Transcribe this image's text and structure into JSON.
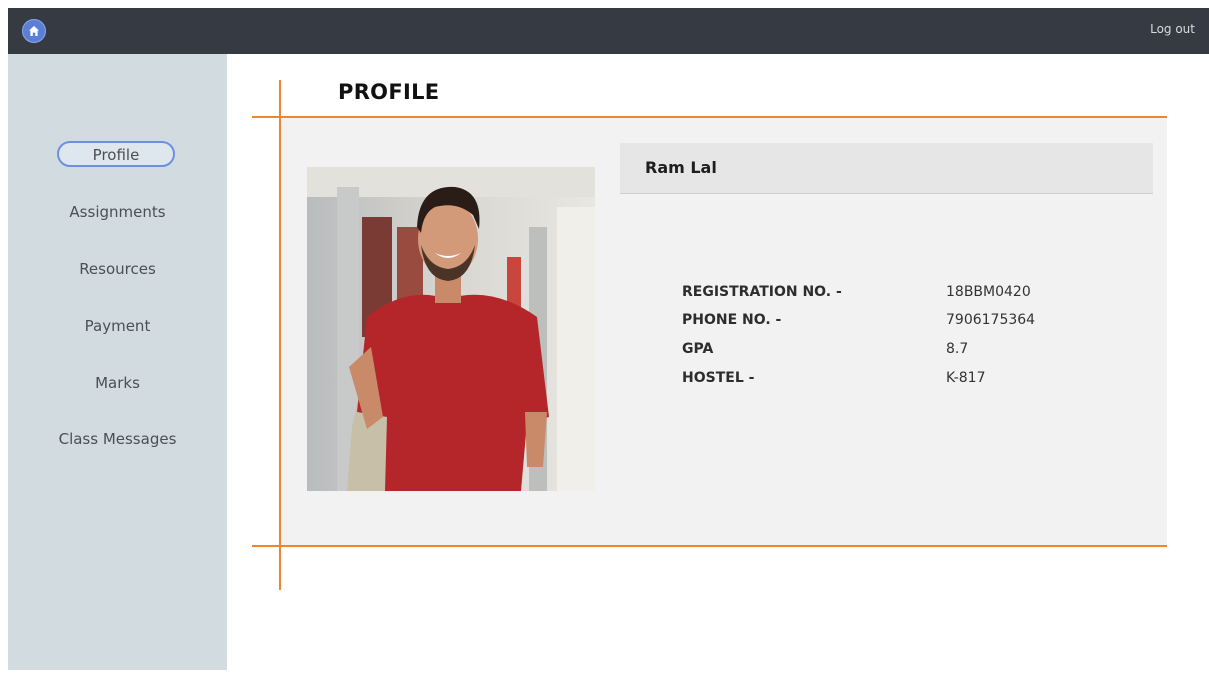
{
  "topbar": {
    "home_icon": "home-icon",
    "logout_label": "Log out",
    "accent_color": "#5b7fd6"
  },
  "sidebar": {
    "items": [
      {
        "label": "Profile",
        "active": true
      },
      {
        "label": "Assignments",
        "active": false
      },
      {
        "label": "Resources",
        "active": false
      },
      {
        "label": "Payment",
        "active": false
      },
      {
        "label": "Marks",
        "active": false
      },
      {
        "label": "Class Messages",
        "active": false
      }
    ]
  },
  "main": {
    "title": "PROFILE",
    "accent_color": "#f0862c",
    "student": {
      "name": "Ram Lal",
      "fields": [
        {
          "label": "REGISTRATION NO. -",
          "value": "18BBM0420"
        },
        {
          "label": "PHONE NO. -",
          "value": "7906175364"
        },
        {
          "label": "GPA",
          "value": "8.7"
        },
        {
          "label": "HOSTEL -",
          "value": "K-817"
        }
      ]
    }
  }
}
